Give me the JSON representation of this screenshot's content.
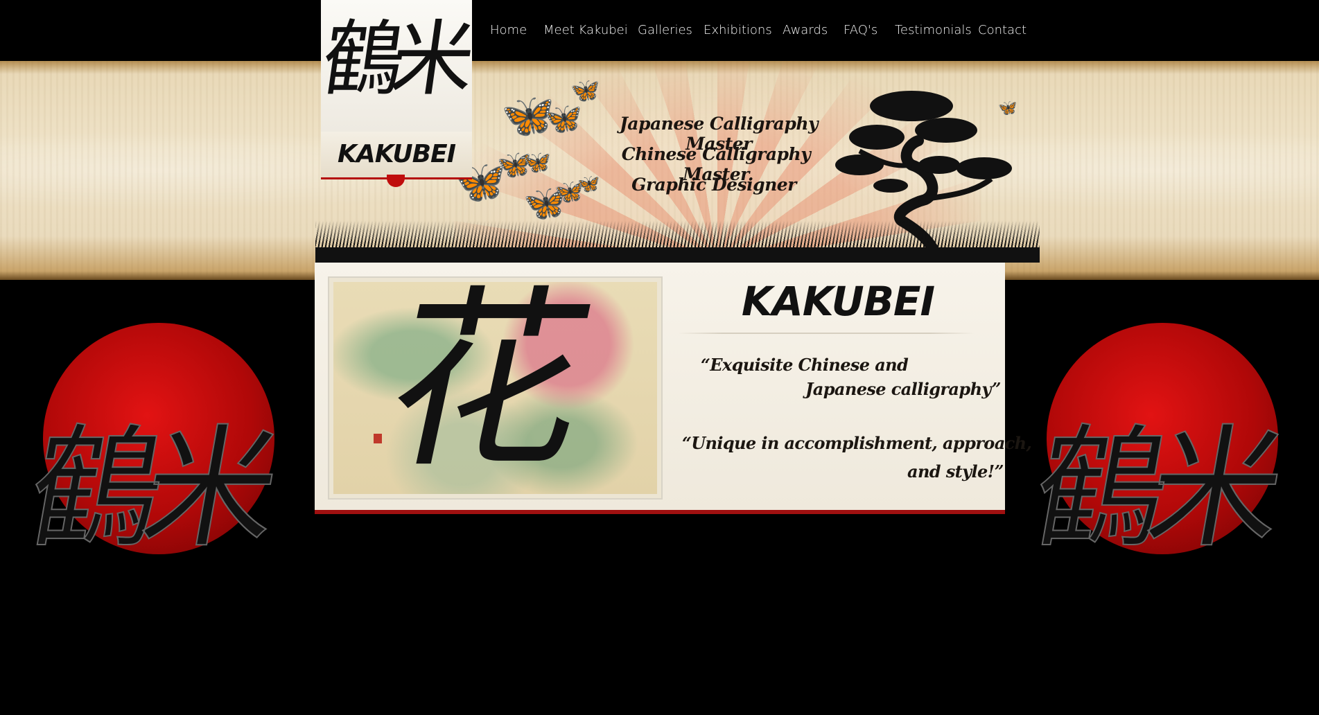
{
  "site": {
    "logo_kanji": "鶴米",
    "logo_name": "KAKUBEI"
  },
  "nav": {
    "items": [
      {
        "label": "Home"
      },
      {
        "label": "Meet Kakubei"
      },
      {
        "label": "Galleries"
      },
      {
        "label": "Exhibitions"
      },
      {
        "label": "Awards"
      },
      {
        "label": "FAQ's"
      },
      {
        "label": "Testimonials"
      },
      {
        "label": "Contact"
      }
    ]
  },
  "hero": {
    "taglines": [
      "Japanese Calligraphy Master",
      "Chinese Calligraphy Master",
      "Graphic Designer"
    ]
  },
  "panel": {
    "title": "KAKUBEI",
    "artwork_kanji": "花",
    "quote1_line1": "“Exquisite Chinese and",
    "quote1_line2": "Japanese calligraphy”",
    "quote2_line1": "“Unique in accomplishment, approach,",
    "quote2_line2": "and style!”"
  },
  "emblem": {
    "kanji": "鶴米"
  },
  "colors": {
    "accent_red": "#c00d0d",
    "nav_text": "#f2f2f2",
    "panel_bg": "#f7f3ea"
  }
}
